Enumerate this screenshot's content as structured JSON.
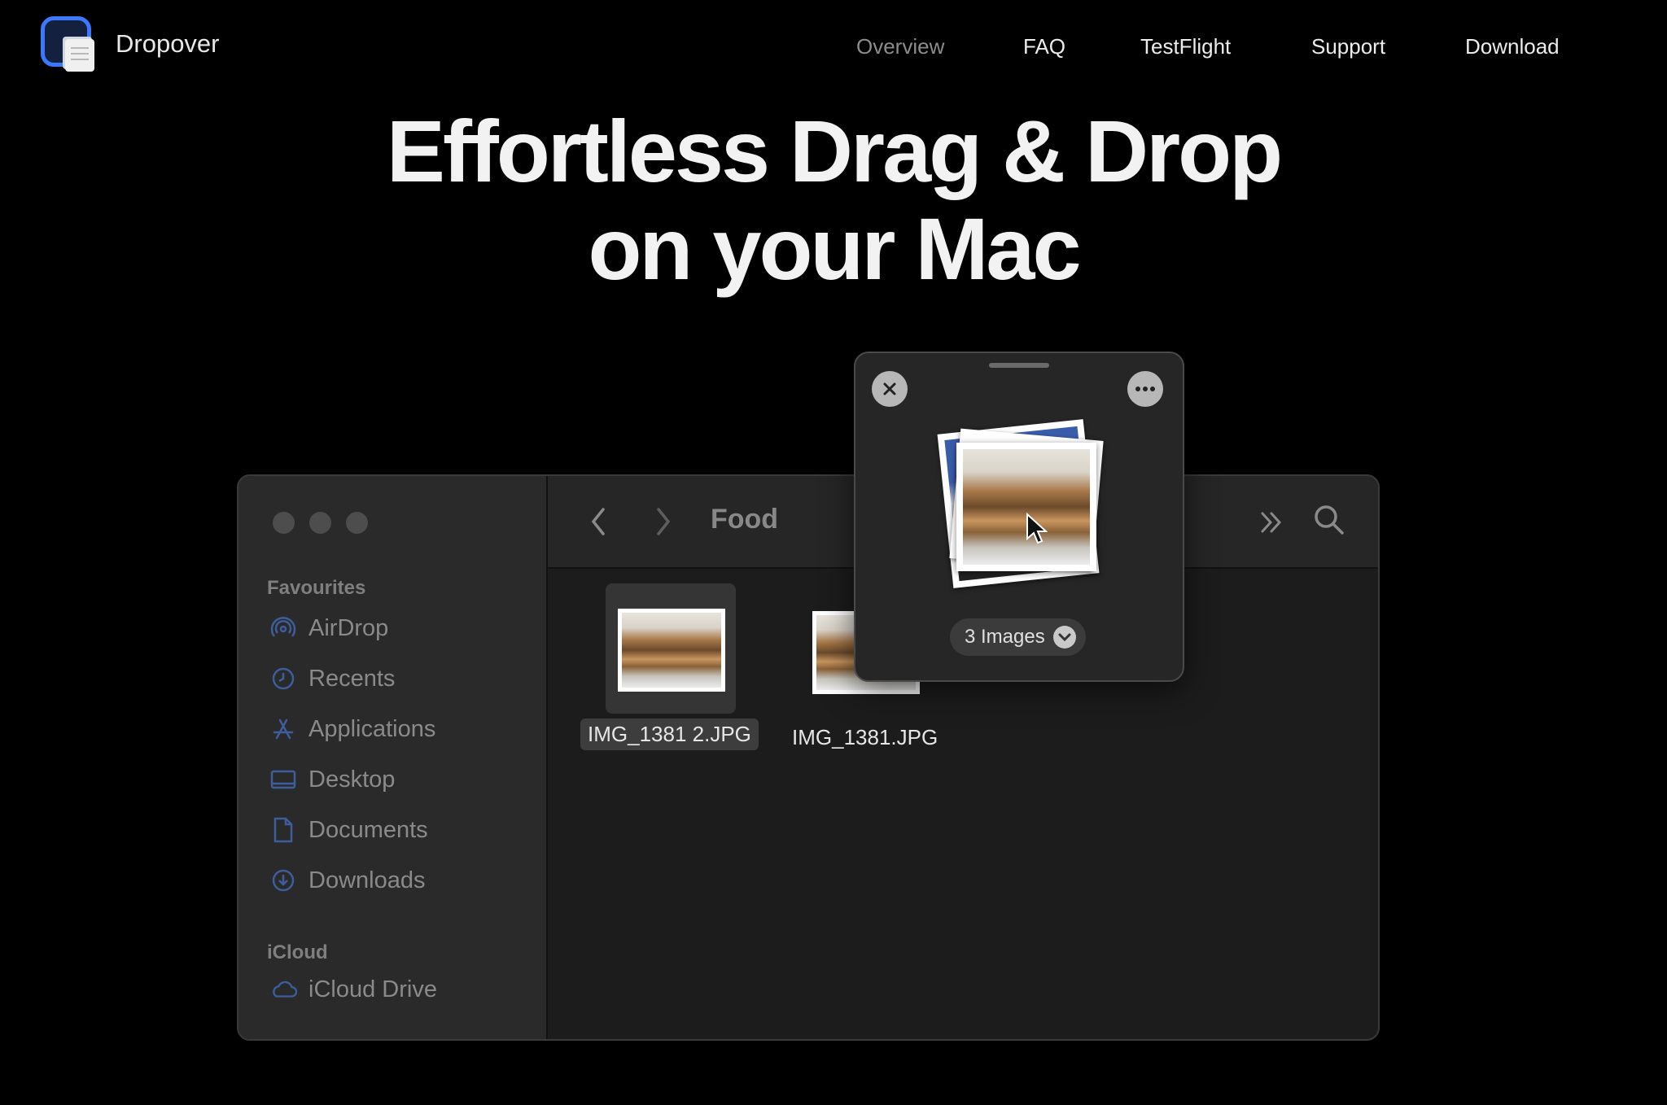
{
  "brand": {
    "name": "Dropover"
  },
  "nav": {
    "overview": "Overview",
    "faq": "FAQ",
    "testflight": "TestFlight",
    "support": "Support",
    "download": "Download"
  },
  "hero": {
    "line1": "Effortless Drag & Drop",
    "line2": "on your Mac"
  },
  "finder": {
    "title": "Food",
    "sidebar": {
      "favourites_label": "Favourites",
      "items": [
        "AirDrop",
        "Recents",
        "Applications",
        "Desktop",
        "Documents",
        "Downloads"
      ],
      "icloud_label": "iCloud",
      "icloud_items": [
        "iCloud Drive"
      ]
    },
    "files": [
      {
        "name": "IMG_1381 2.JPG",
        "selected": true
      },
      {
        "name": "IMG_1381.JPG",
        "selected": false
      }
    ]
  },
  "shelf": {
    "count_label": "3 Images"
  },
  "colors": {
    "accent": "#3b78ff",
    "background": "#000000",
    "window": "#1c1c1c",
    "sidebar": "#2a2a2a"
  }
}
